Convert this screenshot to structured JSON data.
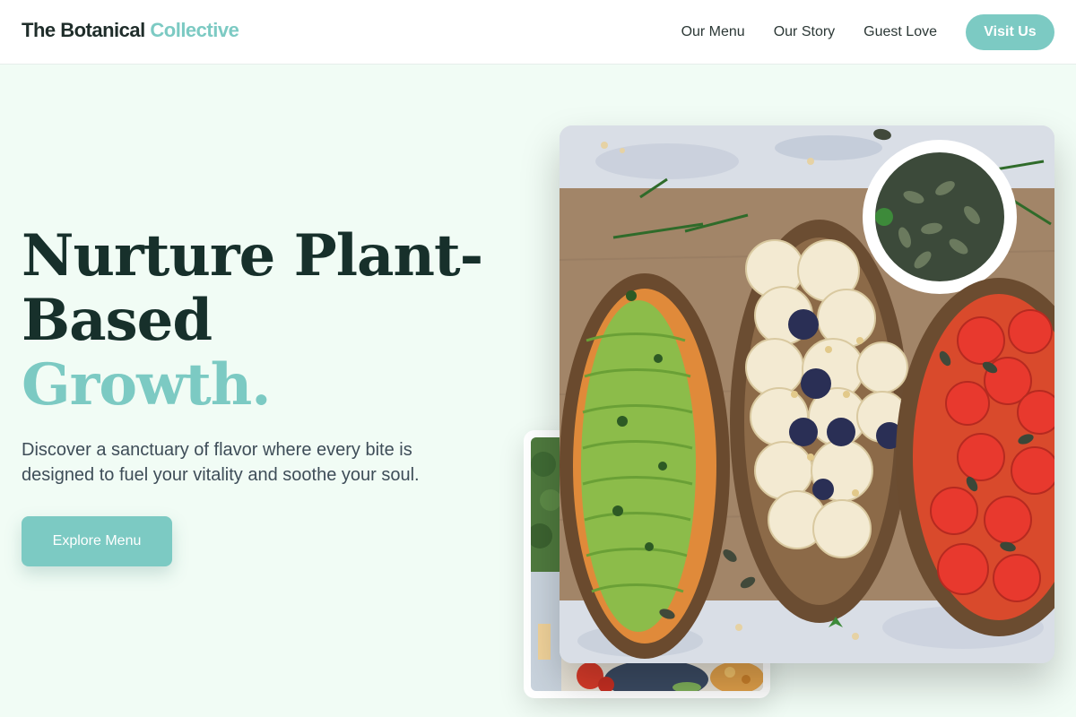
{
  "brand": {
    "name_main": "The Botanical",
    "name_accent": "Collective"
  },
  "nav": {
    "links": [
      "Our Menu",
      "Our Story",
      "Guest Love"
    ],
    "cta_label": "Visit Us"
  },
  "hero": {
    "title_line1": "Nurture Plant-",
    "title_line2": "Based",
    "title_accent": "Growth.",
    "subtitle": "Discover a sanctuary of flavor where every bite is designed to fuel your vitality and soothe your soul.",
    "cta_label": "Explore Menu"
  },
  "colors": {
    "accent": "#7ccac3",
    "heading": "#17302b",
    "page_background": "#f1fcf5",
    "body_text": "#3e4d58"
  },
  "images": {
    "main": "food-photo-avocado-banana-tomato-toast",
    "secondary": "food-photo-table-spread"
  }
}
